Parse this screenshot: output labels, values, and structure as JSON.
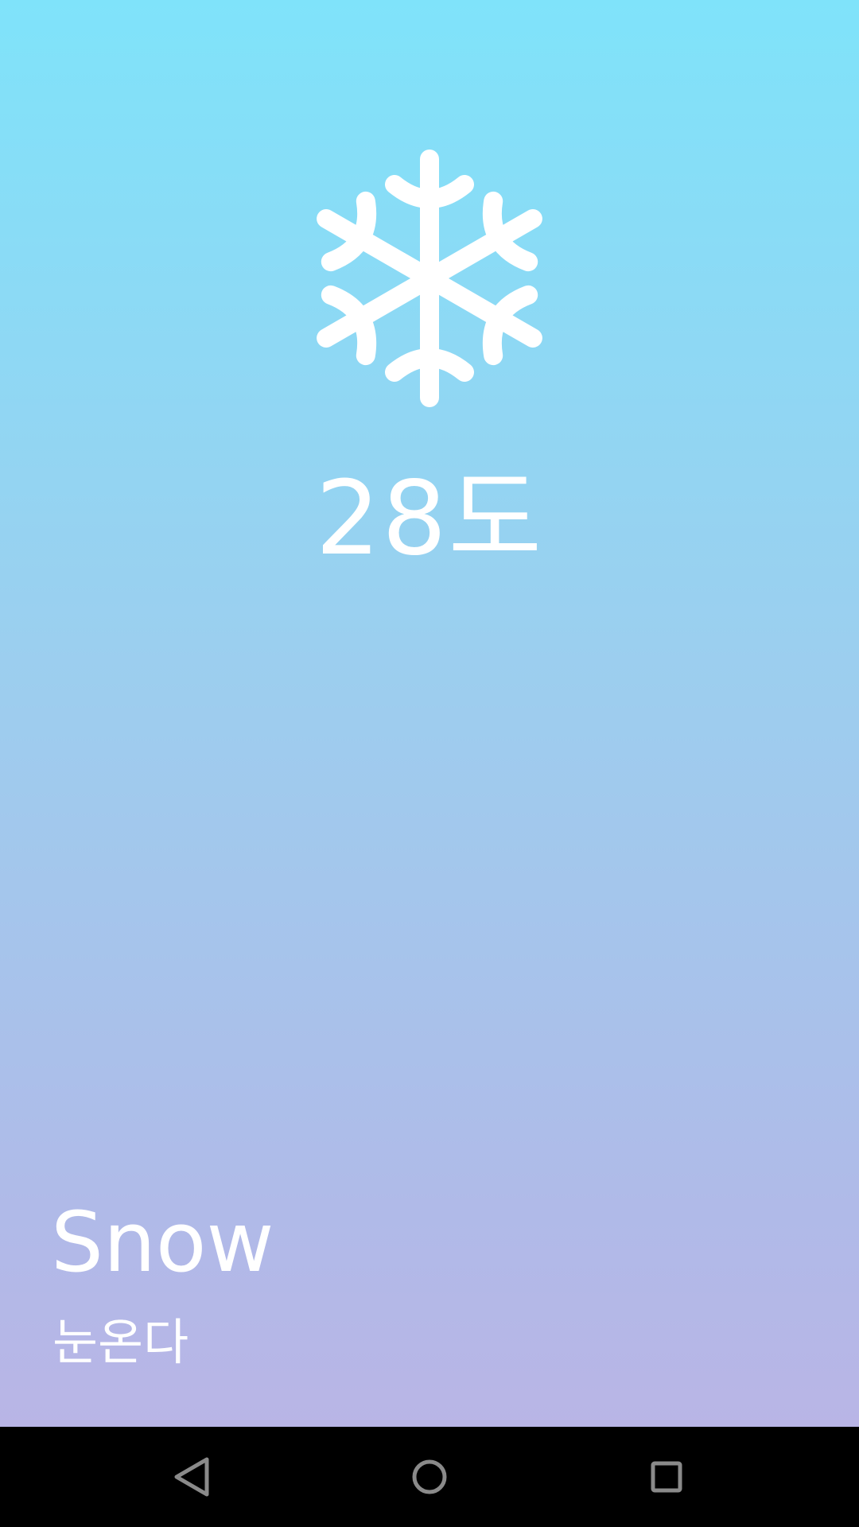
{
  "weather": {
    "icon": "snowflake-icon",
    "temperature": "28도",
    "condition_title": "Snow",
    "condition_subtitle": "눈온다",
    "gradient_top": "#7FE3FA",
    "gradient_bottom": "#B9B5E6"
  },
  "nav_bar": {
    "back_icon": "back-triangle-icon",
    "home_icon": "home-circle-icon",
    "recent_icon": "recent-apps-square-icon",
    "icon_color": "#8A8A8A"
  }
}
